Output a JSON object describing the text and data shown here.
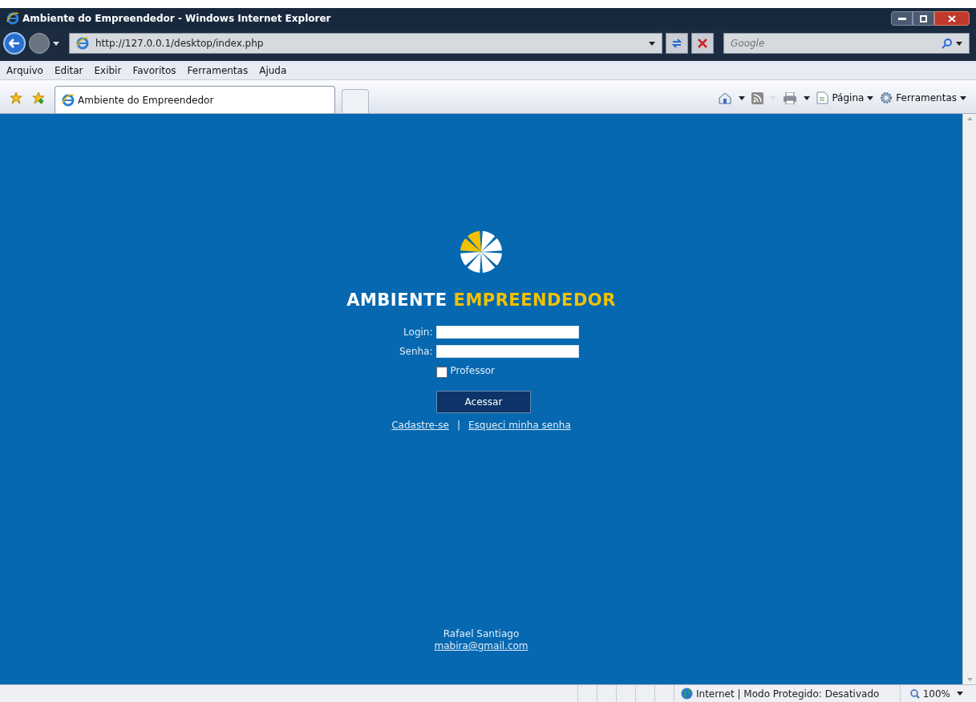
{
  "window": {
    "title": "Ambiente do Empreendedor - Windows Internet Explorer"
  },
  "address_bar": {
    "value": "http://127.0.0.1/desktop/index.php"
  },
  "search": {
    "placeholder": "Google"
  },
  "menu": [
    "Arquivo",
    "Editar",
    "Exibir",
    "Favoritos",
    "Ferramentas",
    "Ajuda"
  ],
  "tabs": [
    {
      "label": "Ambiente do Empreendedor",
      "selected": true
    }
  ],
  "command_bar": [
    "Página",
    "Ferramentas"
  ],
  "page": {
    "brand": {
      "first": "AMBIENTE",
      "second": "EMPREENDEDOR"
    },
    "fields": [
      {
        "label": "Login:"
      },
      {
        "label": "Senha:"
      }
    ],
    "checkbox": {
      "label": "Professor",
      "checked": false
    },
    "button": "Acessar",
    "links": [
      "Cadastre-se",
      "Esqueci minha senha"
    ],
    "separator": "|",
    "footer": {
      "name": "Rafael Santiago",
      "email": "mabira@gmail.com"
    }
  },
  "status_bar": {
    "zone": "Internet | Modo Protegido: Desativado",
    "zoom": "100%"
  }
}
